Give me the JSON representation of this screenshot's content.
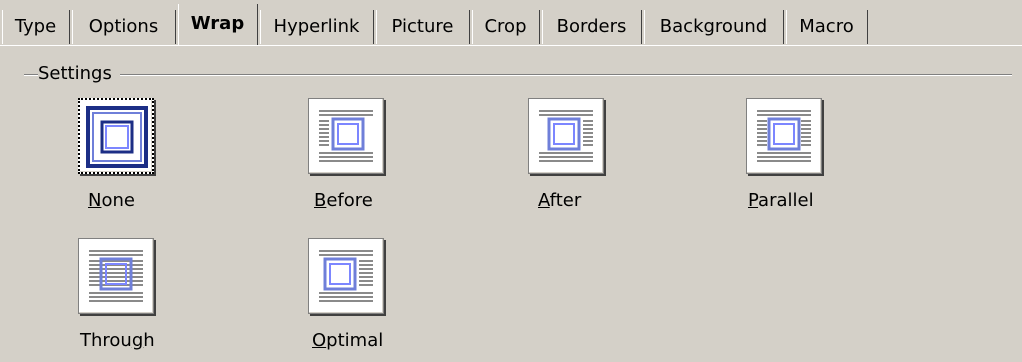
{
  "tabs": [
    {
      "label": "Type"
    },
    {
      "label": "Options"
    },
    {
      "label": "Wrap"
    },
    {
      "label": "Hyperlink"
    },
    {
      "label": "Picture"
    },
    {
      "label": "Crop"
    },
    {
      "label": "Borders"
    },
    {
      "label": "Background"
    },
    {
      "label": "Macro"
    }
  ],
  "active_tab": "Wrap",
  "settings": {
    "group_label": "Settings",
    "options": [
      {
        "mnemonic": "N",
        "rest": "one",
        "label": "None",
        "icon": "wrap-none-icon",
        "selected": true
      },
      {
        "mnemonic": "B",
        "rest": "efore",
        "label": "Before",
        "icon": "wrap-before-icon",
        "selected": false
      },
      {
        "mnemonic": "A",
        "rest": "fter",
        "label": "After",
        "icon": "wrap-after-icon",
        "selected": false
      },
      {
        "mnemonic": "P",
        "rest": "arallel",
        "label": "Parallel",
        "icon": "wrap-parallel-icon",
        "selected": false
      },
      {
        "pre": "Throu",
        "mnemonic": "g",
        "rest": "h",
        "label": "Through",
        "icon": "wrap-through-icon",
        "selected": false
      },
      {
        "mnemonic": "O",
        "rest": "ptimal",
        "label": "Optimal",
        "icon": "wrap-optimal-icon",
        "selected": false
      }
    ]
  },
  "colors": {
    "dialog_bg": "#d4d0c8",
    "frame_blue": "#1c2e86",
    "frame_light_blue": "#7c86ff",
    "text_lines": "#8a8a8a"
  }
}
